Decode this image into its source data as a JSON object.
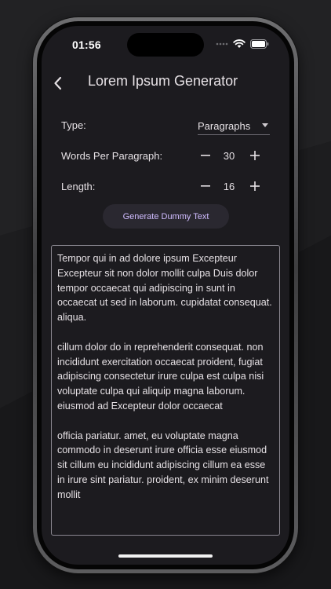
{
  "status_bar": {
    "time": "01:56"
  },
  "app_bar": {
    "title": "Lorem Ipsum Generator",
    "back_icon": "chevron-left-icon"
  },
  "settings": {
    "type_label": "Type:",
    "type_value": "Paragraphs",
    "words_label": "Words Per Paragraph:",
    "words_value": "30",
    "length_label": "Length:",
    "length_value": "16"
  },
  "actions": {
    "generate_label": "Generate Dummy Text"
  },
  "output": {
    "paragraphs": [
      "Tempor qui in ad dolore ipsum Excepteur Excepteur sit non dolor mollit culpa Duis dolor tempor occaecat qui adipiscing in sunt in occaecat ut sed in laborum. cupidatat consequat. aliqua.",
      "cillum dolor do in reprehenderit consequat. non incididunt exercitation occaecat proident, fugiat adipiscing consectetur irure culpa est culpa nisi voluptate culpa qui aliquip magna laborum. eiusmod ad Excepteur dolor occaecat",
      "officia pariatur. amet, eu voluptate magna commodo in deserunt irure officia esse eiusmod sit cillum eu incididunt adipiscing cillum ea esse in irure sint pariatur. proident, ex minim deserunt mollit"
    ]
  },
  "colors": {
    "background": "#1c1b1f",
    "accent": "#d0bcff",
    "text": "#e6e1e5"
  }
}
